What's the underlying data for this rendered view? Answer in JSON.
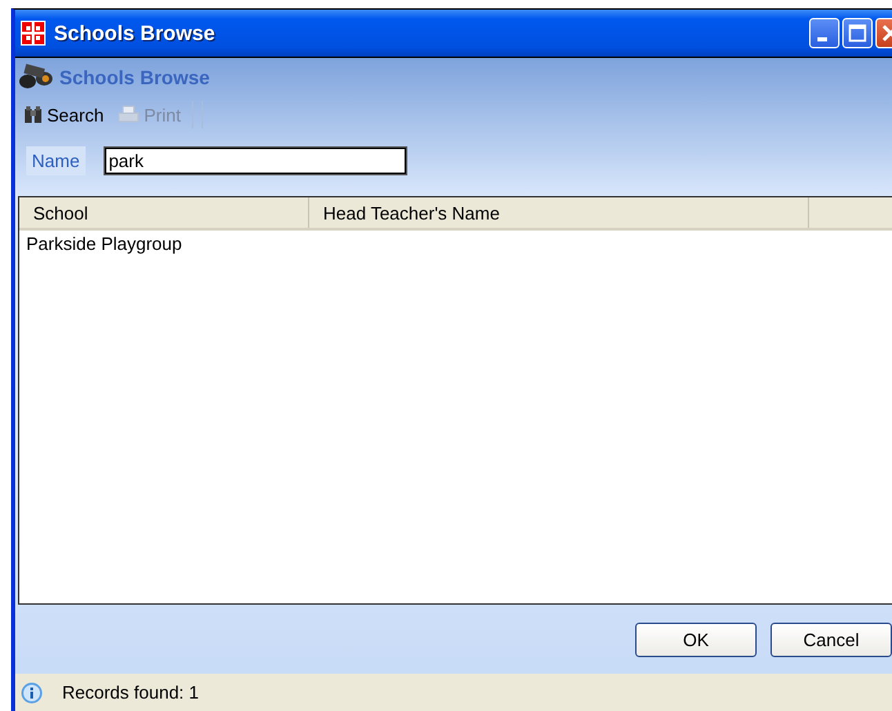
{
  "window": {
    "title": "Schools Browse"
  },
  "header": {
    "title": "Schools Browse"
  },
  "toolbar": [
    {
      "label": "Search",
      "kind": "search",
      "disabled": false
    },
    {
      "label": "Print",
      "kind": "print",
      "disabled": true
    }
  ],
  "filter": {
    "label": "Name",
    "value": "park"
  },
  "table": {
    "columns": [
      "School",
      "Head Teacher's Name"
    ],
    "rows": [
      [
        "Parkside Playgroup",
        ""
      ]
    ]
  },
  "buttons": [
    "OK",
    "Cancel"
  ],
  "status_bar": {
    "text": "Records found: 1"
  }
}
